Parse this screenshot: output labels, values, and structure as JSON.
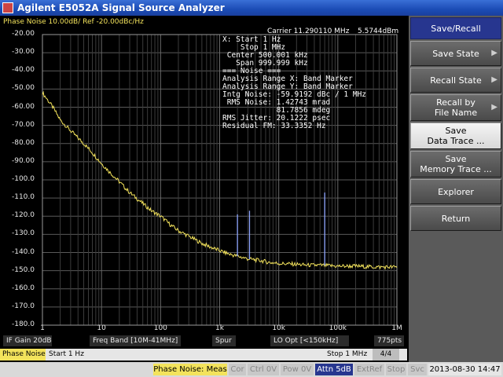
{
  "window": {
    "title": "Agilent E5052A Signal Source Analyzer"
  },
  "trace": {
    "title": "Phase Noise 10.00dB/ Ref -20.00dBc/Hz"
  },
  "carrier": {
    "label": "Carrier 11.290110 MHz",
    "value": "5.5744dBm"
  },
  "info_lines": [
    "X: Start 1 Hz",
    "    Stop 1 MHz",
    " Center 500.001 kHz",
    "   Span 999.999 kHz",
    "=== Noise ===",
    "Analysis Range X: Band Marker",
    "Analysis Range Y: Band Marker",
    "Intg Noise: -59.9192 dBc / 1 MHz",
    " RMS Noise: 1.42743 mrad",
    "            81.7856 mdeg",
    "RMS Jitter: 20.1222 psec",
    "Residual FM: 33.3352 Hz"
  ],
  "chart_data": {
    "type": "line",
    "title": "Phase Noise 10.00dB/ Ref -20.00dBc/Hz",
    "xlabel": "",
    "ylabel": "",
    "x_scale": "log",
    "xlim": [
      1,
      1000000
    ],
    "ylim": [
      -180,
      -20
    ],
    "grid": true,
    "x_ticks": [
      "1",
      "10",
      "100",
      "1k",
      "10k",
      "100k",
      "1M"
    ],
    "y_ticks": [
      "-20.00",
      "-30.00",
      "-40.00",
      "-50.00",
      "-60.00",
      "-70.00",
      "-80.00",
      "-90.00",
      "-100.0",
      "-110.0",
      "-120.0",
      "-130.0",
      "-140.0",
      "-150.0",
      "-160.0",
      "-170.0",
      "-180.0"
    ],
    "series": [
      {
        "color": "#f3e35c",
        "x": [
          1,
          1.5,
          2,
          3,
          5,
          7,
          10,
          15,
          20,
          30,
          50,
          70,
          100,
          150,
          200,
          300,
          500,
          700,
          1000,
          1500,
          2000,
          3000,
          5000,
          7000,
          10000,
          20000,
          30000,
          50000,
          100000,
          200000,
          300000,
          500000,
          1000000
        ],
        "y": [
          -52,
          -60,
          -67,
          -73,
          -80,
          -85,
          -91,
          -97,
          -101,
          -107,
          -113,
          -117,
          -120,
          -125,
          -128,
          -131,
          -135,
          -137,
          -139,
          -141,
          -142,
          -143.5,
          -144.5,
          -145.5,
          -146,
          -146.5,
          -147,
          -147,
          -147.5,
          -147.5,
          -147.8,
          -148,
          -148
        ]
      }
    ],
    "spurs": [
      {
        "x": 2000,
        "y": -119
      },
      {
        "x": 3200,
        "y": -117
      },
      {
        "x": 60000,
        "y": -107
      }
    ]
  },
  "statusbar1": [
    {
      "label": "IF Gain 20dB"
    },
    {
      "label": "Freq Band [10M-41MHz]"
    },
    {
      "label": "Spur"
    },
    {
      "label": "LO Opt [<150kHz]"
    },
    {
      "label": "775pts"
    }
  ],
  "statusbar2": {
    "mode": "Phase Noise",
    "start": "Start 1 Hz",
    "stop": "Stop 1 MHz",
    "page": "4/4"
  },
  "softkeys": {
    "header": "Save/Recall",
    "items": [
      {
        "label": "Save State",
        "line2": ""
      },
      {
        "label": "Recall State",
        "line2": ""
      },
      {
        "label": "Recall by",
        "line2": "File Name"
      },
      {
        "label": "Save",
        "line2": "Data Trace ..."
      },
      {
        "label": "Save",
        "line2": "Memory Trace ..."
      },
      {
        "label": "Explorer",
        "line2": ""
      },
      {
        "label": "Return",
        "line2": ""
      }
    ],
    "arrow": "▶"
  },
  "bottombar": {
    "items": [
      "Phase Noise: Meas",
      "Cor",
      "Ctrl 0V",
      "Pow 0V",
      "Attn 5dB",
      "ExtRef",
      "Stop",
      "Svc"
    ],
    "datetime": "2013-08-30 14:47"
  },
  "colors": {
    "trace": "#f3e35c",
    "softkey_header": "#27368f",
    "title_bar": "#1b4cb5"
  }
}
